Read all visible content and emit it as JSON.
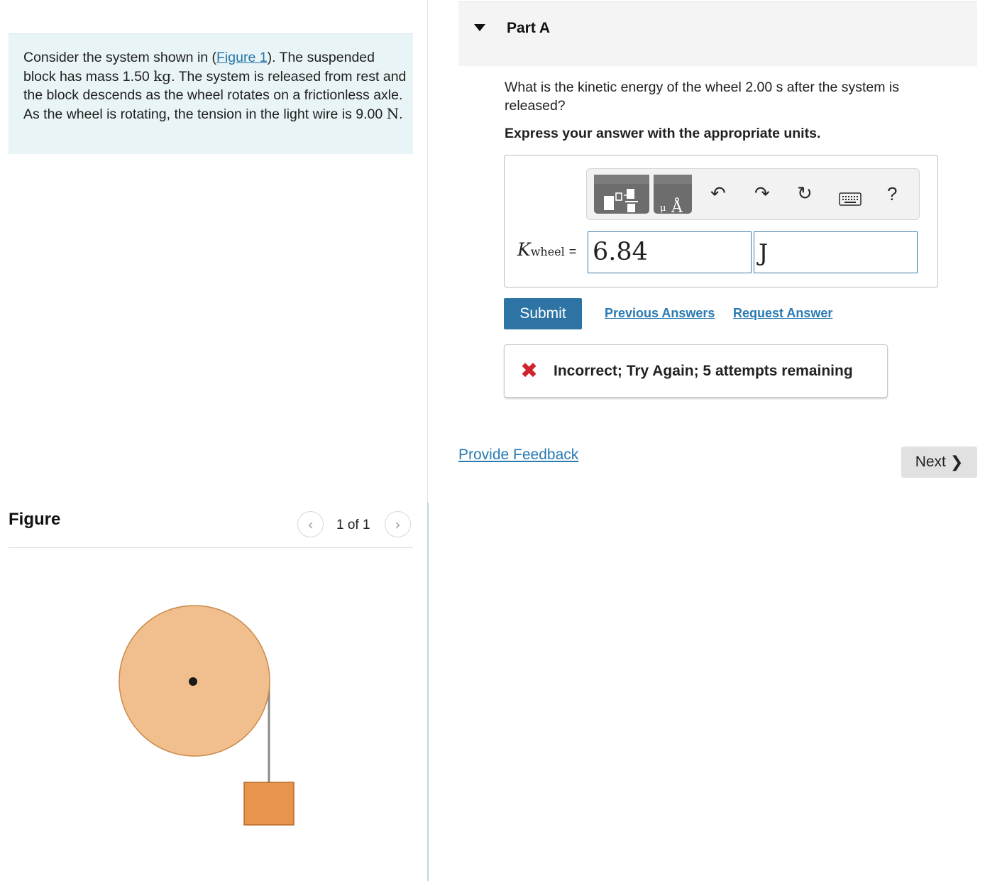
{
  "problem": {
    "text_before_link": "Consider the system shown in (",
    "figure_link": "Figure 1",
    "text_after_link": "). The suspended block has mass 1.50 ",
    "mass_unit": "kg",
    "text_middle": ". The system is released from rest and the block descends as the wheel rotates on a frictionless axle. As the wheel is rotating, the tension in the light wire is 9.00 ",
    "tension_unit": "N",
    "text_end": "."
  },
  "figure": {
    "title": "Figure",
    "counter": "1 of 1",
    "prev_icon": "chevron-left-icon",
    "next_icon": "chevron-right-icon",
    "colors": {
      "wheel": "#f0bf8d",
      "wheel_stroke": "#c98a4a",
      "block": "#e8944d",
      "block_stroke": "#b86a2a",
      "wire": "#8a8a8a"
    }
  },
  "part": {
    "title": "Part A",
    "question": "What is the kinetic energy of the wheel 2.00 s after the system is released?",
    "instruction": "Express your answer with the appropriate units."
  },
  "answer": {
    "variable": "K",
    "subscript": "wheel",
    "equals": "=",
    "value": "6.84",
    "unit": "J",
    "toolbar_icons": [
      "templates-icon",
      "units-icon",
      "undo-icon",
      "redo-icon",
      "reset-icon",
      "keyboard-icon",
      "help-icon"
    ],
    "help_label": "?"
  },
  "actions": {
    "submit": "Submit",
    "previous_answers": "Previous Answers",
    "request_answer": "Request Answer"
  },
  "feedback": {
    "icon": "x-icon",
    "message": "Incorrect; Try Again; 5 attempts remaining",
    "color": "#d0232b"
  },
  "footer": {
    "provide_feedback": "Provide Feedback",
    "next": "Next"
  }
}
